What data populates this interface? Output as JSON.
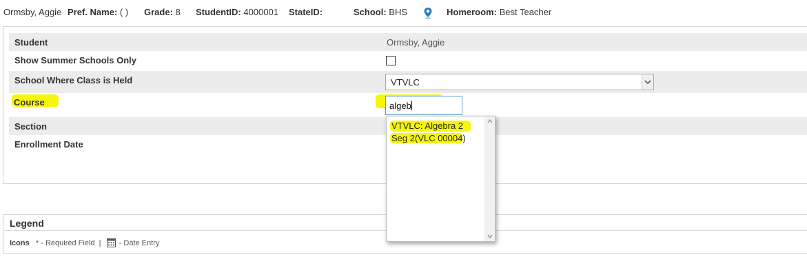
{
  "header": {
    "student_name": "Ormsby, Aggie",
    "pref_name_label": "Pref. Name:",
    "pref_name_value": "( )",
    "grade_label": "Grade:",
    "grade_value": "8",
    "student_id_label": "StudentID:",
    "student_id_value": "4000001",
    "state_id_label": "StateID:",
    "school_label": "School:",
    "school_value": "BHS",
    "homeroom_label": "Homeroom:",
    "homeroom_value": "Best Teacher"
  },
  "form": {
    "student_label": "Student",
    "student_value": "Ormsby, Aggie",
    "summer_label": "Show Summer Schools Only",
    "summer_checked": false,
    "school_label": "School Where Class is Held",
    "school_selected": "VTVLC",
    "course_label": "Course",
    "course_value": "algeb",
    "section_label": "Section",
    "enrollment_label": "Enrollment Date"
  },
  "dropdown": {
    "items": [
      {
        "line1": "VTVLC: Algebra 2",
        "line2": "Seg 2(VLC 00004)"
      }
    ]
  },
  "legend": {
    "title": "Legend",
    "icons_label": "Icons",
    "required_text": "* - Required Field",
    "separator": "|",
    "date_entry_text": "- Date Entry"
  },
  "colors": {
    "highlight": "#f6f600",
    "row_shade": "#ececec",
    "focus_border": "#5a9ed6",
    "pin": "#2a7fc4"
  }
}
